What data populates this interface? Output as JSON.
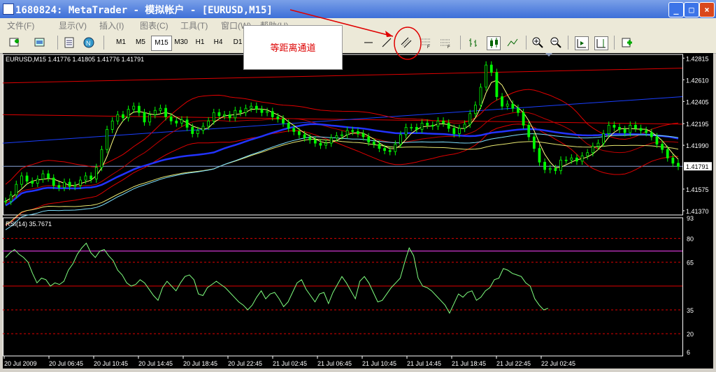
{
  "window": {
    "title": "1680824: MetaTrader - 模拟帐户 - [EURUSD,M15]",
    "min_icon": "minimize-icon",
    "max_icon": "maximize-icon",
    "close_icon": "close-icon"
  },
  "menu": {
    "items": [
      "文件(F)",
      "显示(V)",
      "插入(I)",
      "图表(C)",
      "工具(T)",
      "窗口(W)",
      "帮助(H)"
    ]
  },
  "toolbar": {
    "timeframes": [
      "M1",
      "M5",
      "M15",
      "M30",
      "H1",
      "H4",
      "D1"
    ],
    "active_timeframe": "M15",
    "icons": [
      "new-chart-icon",
      "profiles-icon",
      "market-watch-icon",
      "navigator-icon",
      "line-icon",
      "trendline-icon",
      "equidistant-channel-icon",
      "fibo-icon",
      "fibo-fan-icon",
      "bar-chart-icon",
      "candle-chart-icon",
      "line-chart-icon",
      "zoom-in-icon",
      "zoom-out-icon",
      "autoscroll-icon",
      "chart-shift-icon",
      "indicators-icon"
    ]
  },
  "annotation": {
    "label": "等距离通道",
    "color": "#e00000"
  },
  "chart_data": {
    "type": "line",
    "title": "EURUSD,M15  1.41776 1.41805 1.41776 1.41791",
    "last_price_label": "1.41791",
    "y_ticks": [
      "1.42815",
      "1.42610",
      "1.42405",
      "1.42195",
      "1.41990",
      "1.41791",
      "1.41575",
      "1.41370"
    ],
    "x_labels": [
      "20 Jul 2009",
      "20 Jul 06:45",
      "20 Jul 10:45",
      "20 Jul 14:45",
      "20 Jul 18:45",
      "20 Jul 22:45",
      "21 Jul 02:45",
      "21 Jul 06:45",
      "21 Jul 10:45",
      "21 Jul 14:45",
      "21 Jul 18:45",
      "21 Jul 22:45",
      "22 Jul 02:45"
    ],
    "ylim": [
      1.4133,
      1.4285
    ],
    "price": [
      1.4146,
      1.4152,
      1.4162,
      1.417,
      1.4165,
      1.4163,
      1.4167,
      1.4172,
      1.4168,
      1.4161,
      1.4159,
      1.4164,
      1.416,
      1.4161,
      1.4166,
      1.417,
      1.4167,
      1.4178,
      1.4195,
      1.4214,
      1.4222,
      1.4228,
      1.4225,
      1.4233,
      1.4236,
      1.423,
      1.4221,
      1.4228,
      1.4232,
      1.4234,
      1.4226,
      1.4222,
      1.422,
      1.4223,
      1.4216,
      1.421,
      1.4213,
      1.4217,
      1.4222,
      1.423,
      1.4227,
      1.4228,
      1.4225,
      1.4232,
      1.423,
      1.4234,
      1.4236,
      1.4233,
      1.423,
      1.4231,
      1.4226,
      1.4224,
      1.422,
      1.4215,
      1.4212,
      1.4209,
      1.4206,
      1.4204,
      1.4201,
      1.4199,
      1.4201,
      1.4206,
      1.4208,
      1.4209,
      1.4213,
      1.4212,
      1.421,
      1.4207,
      1.4202,
      1.42,
      1.4196,
      1.4194,
      1.4193,
      1.42,
      1.4209,
      1.4216,
      1.4216,
      1.4214,
      1.422,
      1.4218,
      1.4217,
      1.4222,
      1.422,
      1.4215,
      1.421,
      1.4215,
      1.4219,
      1.4229,
      1.4237,
      1.4254,
      1.4275,
      1.4268,
      1.4245,
      1.4236,
      1.4238,
      1.4234,
      1.423,
      1.4218,
      1.4207,
      1.4196,
      1.4183,
      1.4176,
      1.4177,
      1.4175,
      1.4185,
      1.4185,
      1.4187,
      1.4184,
      1.4189,
      1.4192,
      1.4198,
      1.4201,
      1.421,
      1.4218,
      1.4216,
      1.4214,
      1.4211,
      1.4218,
      1.4215,
      1.4213,
      1.4211,
      1.4207,
      1.42,
      1.4195,
      1.4187,
      1.4182,
      1.4179
    ],
    "rsi": {
      "label": "RSI(14) 35.7671",
      "value": 35.7671,
      "levels": [
        80,
        72,
        65,
        50,
        35
      ],
      "ticks": [
        "93",
        "80",
        "65",
        "35",
        "20",
        "6"
      ],
      "ylim": [
        6,
        93
      ],
      "values": [
        68,
        71,
        73,
        70,
        68,
        65,
        58,
        52,
        55,
        54,
        50,
        52,
        51,
        53,
        60,
        64,
        70,
        74,
        77,
        71,
        68,
        72,
        73,
        69,
        66,
        60,
        57,
        52,
        50,
        51,
        54,
        52,
        48,
        44,
        41,
        49,
        53,
        50,
        47,
        52,
        56,
        57,
        54,
        45,
        44,
        49,
        51,
        53,
        51,
        49,
        46,
        43,
        40,
        38,
        35,
        38,
        43,
        47,
        42,
        45,
        46,
        42,
        37,
        40,
        46,
        52,
        54,
        48,
        44,
        40,
        45,
        46,
        39,
        46,
        51,
        56,
        52,
        47,
        42,
        53,
        56,
        52,
        46,
        40,
        41,
        45,
        49,
        52,
        55,
        65,
        74,
        69,
        55,
        50,
        49,
        47,
        44,
        41,
        38,
        33,
        39,
        45,
        43,
        46,
        47,
        41,
        43,
        47,
        49,
        54,
        55,
        61,
        60,
        58,
        57,
        56,
        52,
        50,
        42,
        38,
        35,
        36
      ]
    }
  }
}
